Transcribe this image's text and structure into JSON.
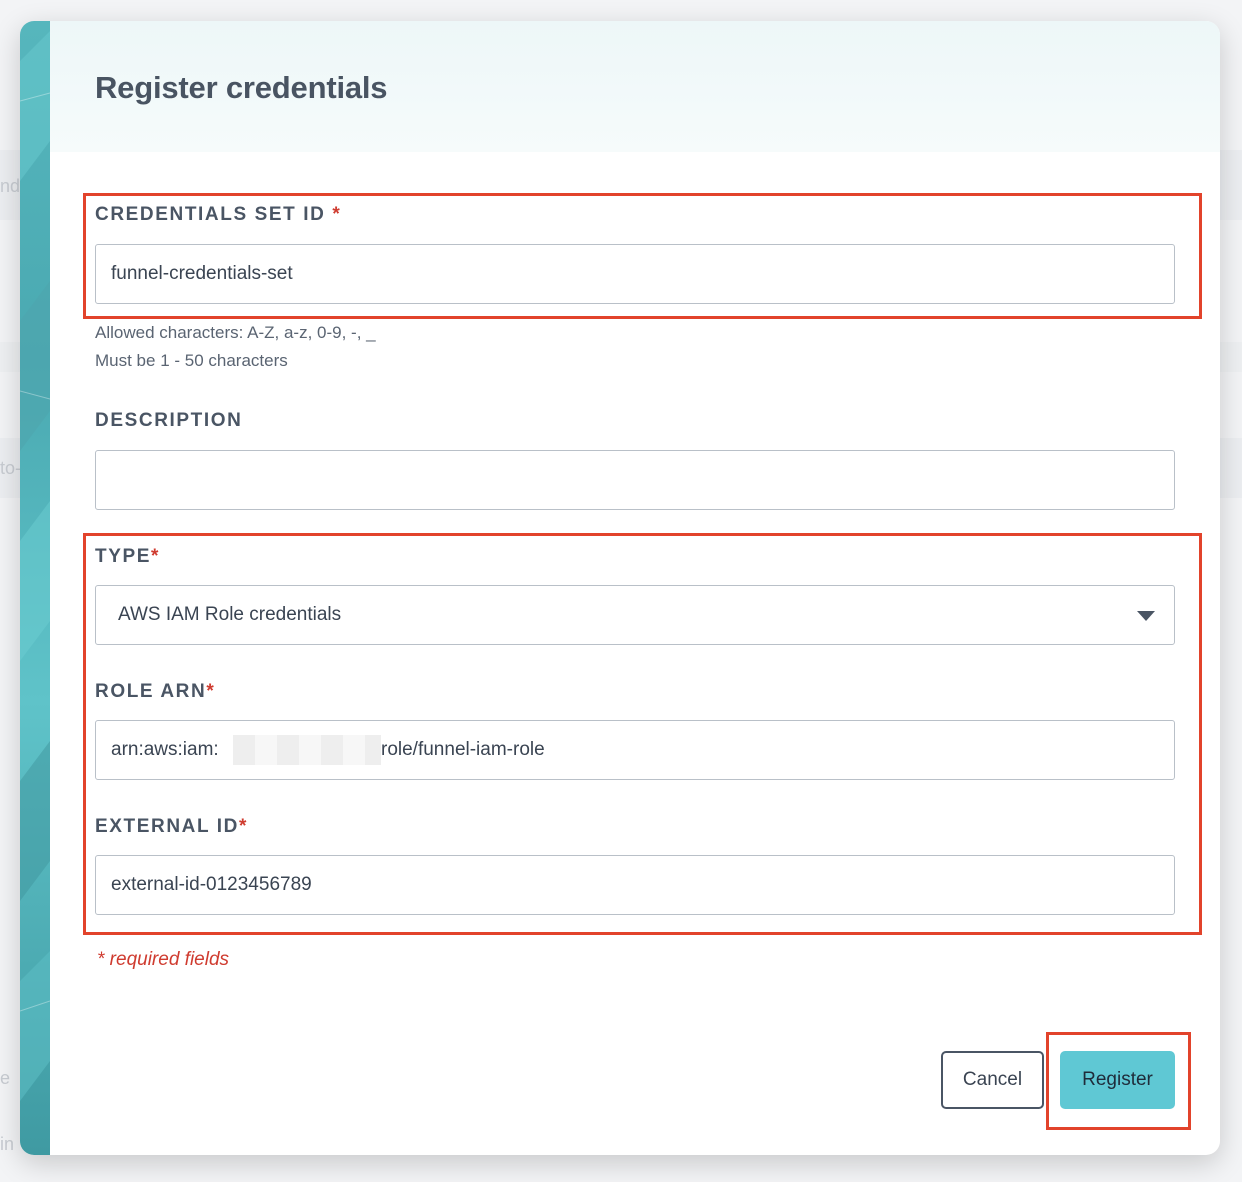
{
  "background": {
    "fragments": [
      "nd",
      "to-",
      "e",
      "in"
    ]
  },
  "modal": {
    "title": "Register credentials",
    "fields": {
      "credentials_set_id": {
        "label": "CREDENTIALS SET ID",
        "required_mark": " *",
        "value": "funnel-credentials-set",
        "hint_allowed": "Allowed characters: A-Z, a-z, 0-9, -, _",
        "hint_length": "Must be 1 - 50 characters"
      },
      "description": {
        "label": "DESCRIPTION",
        "value": ""
      },
      "type": {
        "label": "TYPE",
        "required_mark": "*",
        "selected": "AWS IAM Role credentials"
      },
      "role_arn": {
        "label": "ROLE ARN",
        "required_mark": "*",
        "value_prefix": "arn:aws:iam:",
        "value_suffix": "role/funnel-iam-role"
      },
      "external_id": {
        "label": "EXTERNAL ID",
        "required_mark": "*",
        "value": "external-id-0123456789"
      }
    },
    "required_note": "* required fields",
    "buttons": {
      "cancel": "Cancel",
      "register": "Register"
    }
  },
  "colors": {
    "accent": "#5fc8d4",
    "required": "#cf3b2f",
    "highlight": "#e2432b"
  }
}
